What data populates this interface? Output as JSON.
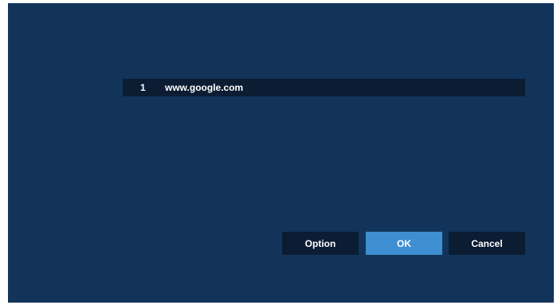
{
  "list": {
    "items": [
      {
        "index": "1",
        "url": "www.google.com"
      }
    ]
  },
  "buttons": {
    "option_label": "Option",
    "ok_label": "OK",
    "cancel_label": "Cancel"
  },
  "colors": {
    "background": "#12345a",
    "row_background": "#0b1c33",
    "button_background": "#0b1c33",
    "accent": "#3d8fd1",
    "text": "#ffffff"
  }
}
